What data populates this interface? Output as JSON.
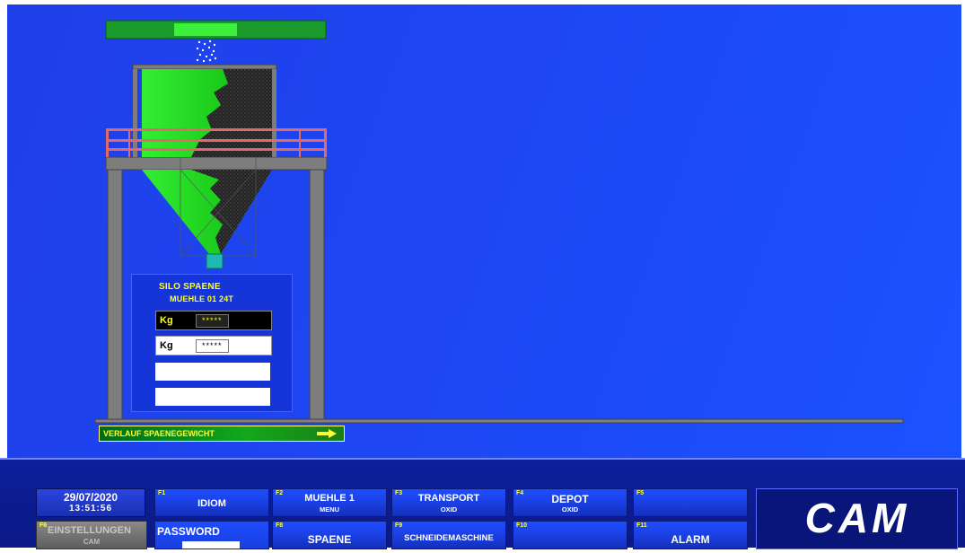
{
  "panel": {
    "title_line1": "SILO SPAENE",
    "title_line2": "MUEHLE 01 24T",
    "kg_label_1": "Kg",
    "kg_value_1": "*****",
    "kg_label_2": "Kg",
    "kg_value_2": "*****"
  },
  "verlauf_label": "VERLAUF SPAENEGEWICHT",
  "footer": {
    "date": "29/07/2020",
    "time": "13:51:56",
    "buttons": [
      {
        "key": "F1",
        "label": "IDIOM",
        "sub": ""
      },
      {
        "key": "F2",
        "label": "MUEHLE 1",
        "sub": "MENU"
      },
      {
        "key": "F3",
        "label": "TRANSPORT",
        "sub": "OXID"
      },
      {
        "key": "F4",
        "label": "DEPOT",
        "sub": "OXID"
      },
      {
        "key": "F5",
        "label": "",
        "sub": ""
      },
      {
        "key": "F6",
        "label": "EINSTELLUNGEN",
        "sub": "CAM"
      },
      {
        "key": "",
        "label": "PASSWORD",
        "sub": ""
      },
      {
        "key": "F8",
        "label": "SPAENE",
        "sub": ""
      },
      {
        "key": "F9",
        "label": "SCHNEIDEMASCHINE",
        "sub": ""
      },
      {
        "key": "F10",
        "label": "",
        "sub": ""
      },
      {
        "key": "F11",
        "label": "ALARM",
        "sub": ""
      }
    ],
    "logo_text": "CAM"
  },
  "colors": {
    "background": "#1e46f2",
    "silo_green": "#22dd22",
    "label_yellow": "#ffff33",
    "railing_red": "#e06a6a"
  }
}
